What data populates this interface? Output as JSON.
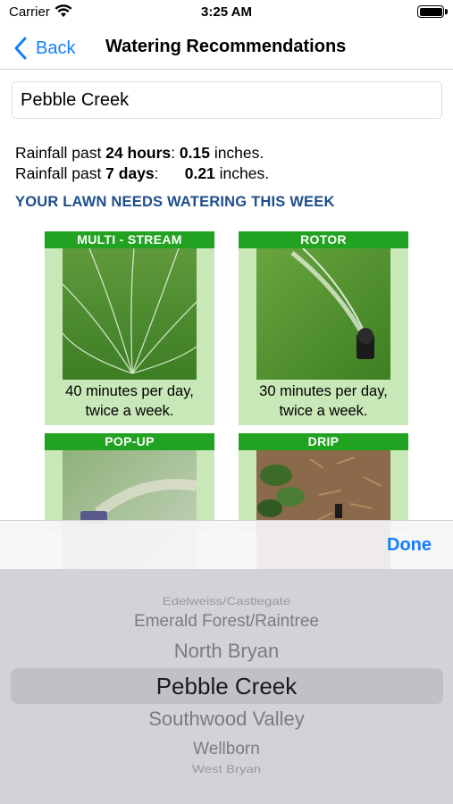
{
  "status_bar": {
    "carrier": "Carrier",
    "time": "3:25 AM"
  },
  "nav": {
    "back_label": "Back",
    "title": "Watering Recommendations"
  },
  "location_field": {
    "value": "Pebble Creek"
  },
  "rainfall": {
    "line1_prefix": "Rainfall past ",
    "line1_period": "24 hours",
    "line1_colon": ":",
    "line1_value": "0.15",
    "line1_unit": "inches.",
    "line2_prefix": "Rainfall past ",
    "line2_period": "7 days",
    "line2_colon": ":",
    "line2_value": "0.21",
    "line2_unit": "inches."
  },
  "notice": "YOUR LAWN NEEDS WATERING THIS WEEK",
  "sprinklers": [
    {
      "title": "MULTI - STREAM",
      "line1": "40 minutes per day,",
      "line2": "twice a week."
    },
    {
      "title": "ROTOR",
      "line1": "30 minutes per day,",
      "line2": "twice a week."
    },
    {
      "title": "POP-UP"
    },
    {
      "title": "DRIP"
    }
  ],
  "picker": {
    "done_label": "Done",
    "options": [
      "Edelweiss/Castlegate",
      "Emerald Forest/Raintree",
      "North Bryan",
      "Pebble Creek",
      "Southwood Valley",
      "Wellborn",
      "West Bryan"
    ],
    "selected": "Pebble Creek"
  },
  "colors": {
    "accent": "#157efb",
    "header_green": "#21a321",
    "card_bg": "#c9e8b8",
    "notice_blue": "#1f4e8c"
  }
}
